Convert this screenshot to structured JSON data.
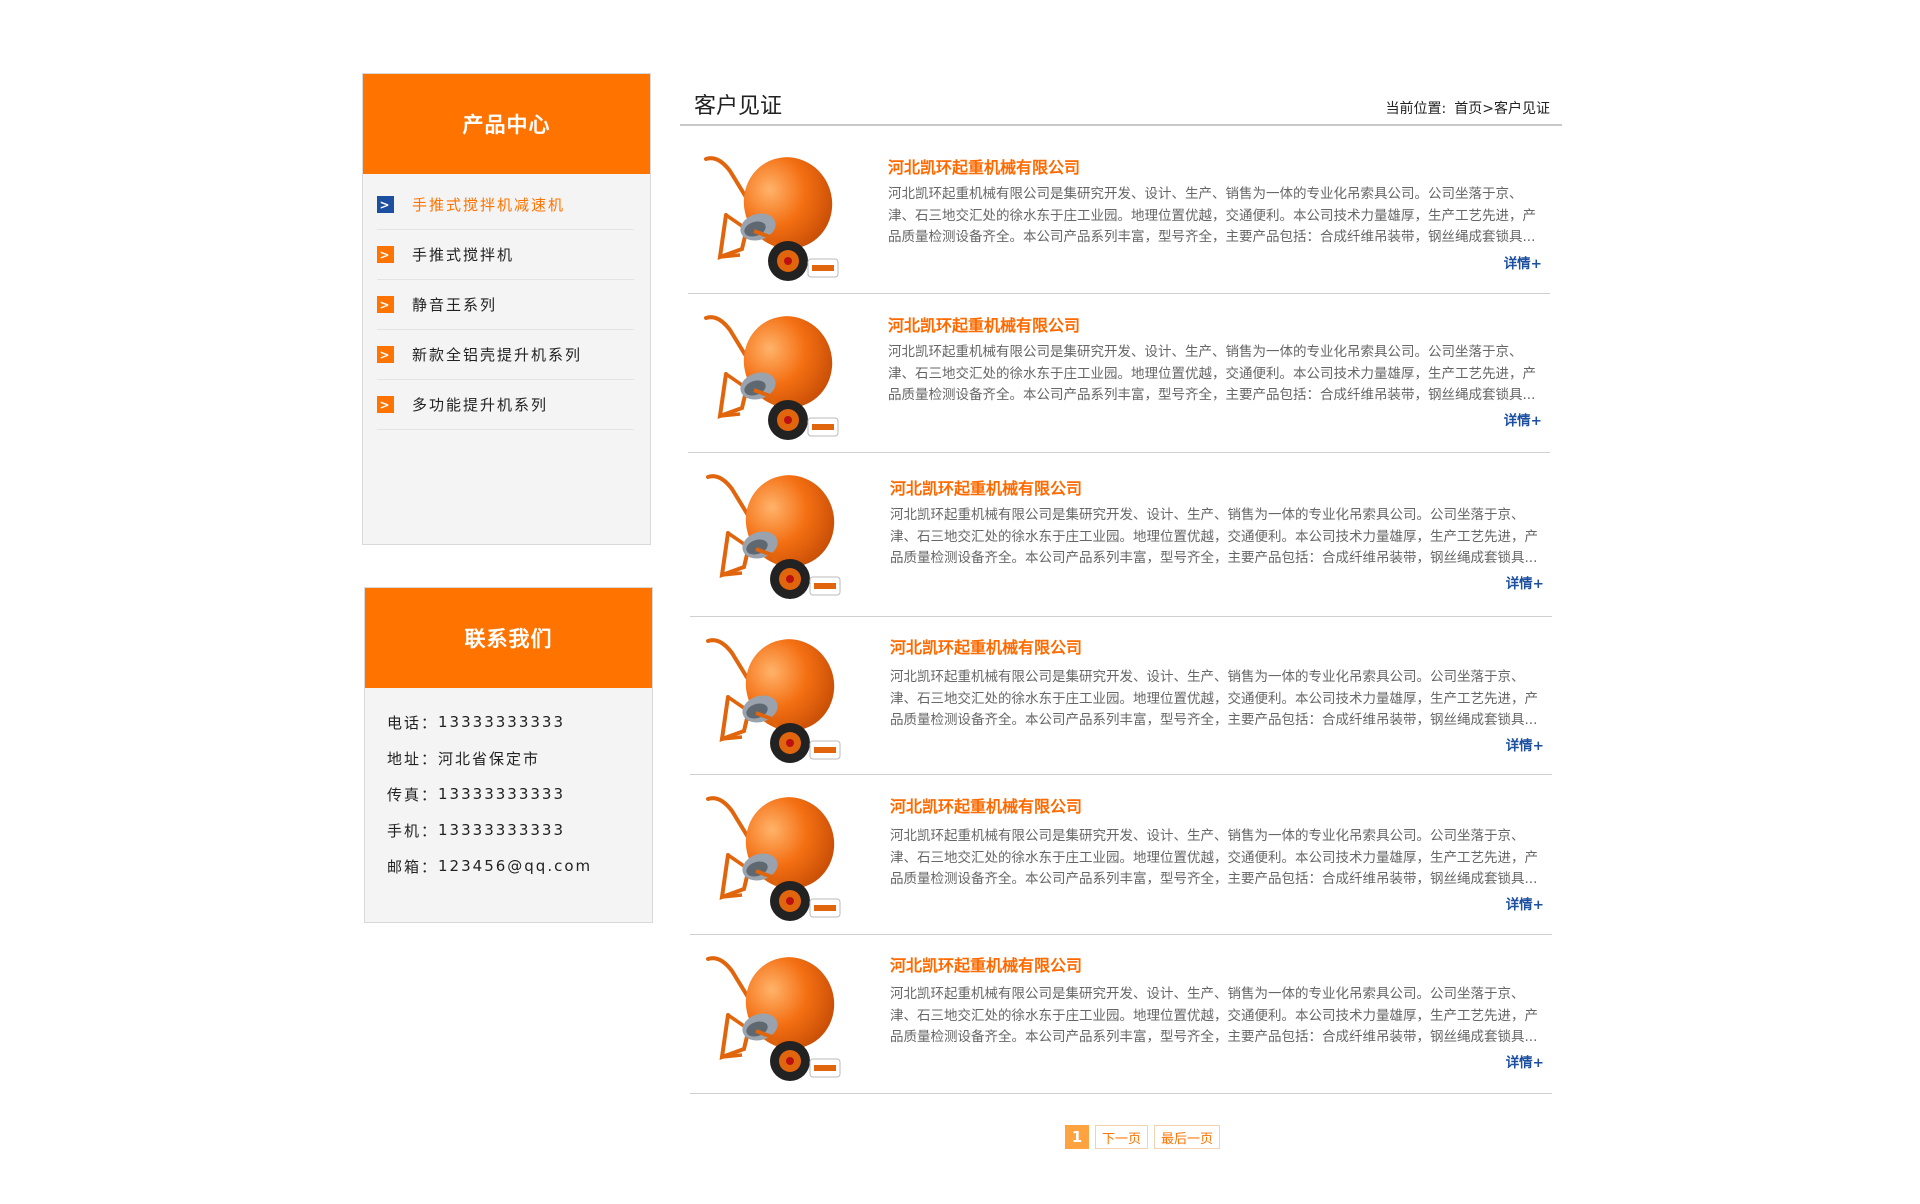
{
  "sidebar": {
    "products": {
      "title": "产品中心",
      "items": [
        {
          "label": "手推式搅拌机减速机",
          "active": true
        },
        {
          "label": "手推式搅拌机",
          "active": false
        },
        {
          "label": "静音王系列",
          "active": false
        },
        {
          "label": "新款全铝壳提升机系列",
          "active": false
        },
        {
          "label": "多功能提升机系列",
          "active": false
        }
      ]
    },
    "contact": {
      "title": "联系我们",
      "rows": [
        {
          "label": "电话：",
          "value": "13333333333"
        },
        {
          "label": "地址：",
          "value": "河北省保定市"
        },
        {
          "label": "传真：",
          "value": "13333333333"
        },
        {
          "label": "手机：",
          "value": "13333333333"
        },
        {
          "label": "邮箱：",
          "value": "123456@qq.com"
        }
      ]
    }
  },
  "main": {
    "title": "客户见证",
    "breadcrumb": {
      "label": "当前位置:",
      "home": "首页",
      "sep": ">",
      "current": "客户见证"
    },
    "entries": [
      {
        "title": "河北凯环起重机械有限公司",
        "desc": "河北凯环起重机械有限公司是集研究开发、设计、生产、销售为一体的专业化吊索具公司。公司坐落于京、津、石三地交汇处的徐水东于庄工业园。地理位置优越，交通便利。本公司技术力量雄厚，生产工艺先进，产品质量检测设备齐全。本公司产品系列丰富，型号齐全，主要产品包括：合成纤维吊装带，钢丝绳成套锁具...",
        "more": "详情+"
      },
      {
        "title": "河北凯环起重机械有限公司",
        "desc": "河北凯环起重机械有限公司是集研究开发、设计、生产、销售为一体的专业化吊索具公司。公司坐落于京、津、石三地交汇处的徐水东于庄工业园。地理位置优越，交通便利。本公司技术力量雄厚，生产工艺先进，产品质量检测设备齐全。本公司产品系列丰富，型号齐全，主要产品包括：合成纤维吊装带，钢丝绳成套锁具...",
        "more": "详情+"
      },
      {
        "title": "河北凯环起重机械有限公司",
        "desc": "河北凯环起重机械有限公司是集研究开发、设计、生产、销售为一体的专业化吊索具公司。公司坐落于京、津、石三地交汇处的徐水东于庄工业园。地理位置优越，交通便利。本公司技术力量雄厚，生产工艺先进，产品质量检测设备齐全。本公司产品系列丰富，型号齐全，主要产品包括：合成纤维吊装带，钢丝绳成套锁具...",
        "more": "详情+"
      },
      {
        "title": "河北凯环起重机械有限公司",
        "desc": "河北凯环起重机械有限公司是集研究开发、设计、生产、销售为一体的专业化吊索具公司。公司坐落于京、津、石三地交汇处的徐水东于庄工业园。地理位置优越，交通便利。本公司技术力量雄厚，生产工艺先进，产品质量检测设备齐全。本公司产品系列丰富，型号齐全，主要产品包括：合成纤维吊装带，钢丝绳成套锁具...",
        "more": "详情+"
      },
      {
        "title": "河北凯环起重机械有限公司",
        "desc": "河北凯环起重机械有限公司是集研究开发、设计、生产、销售为一体的专业化吊索具公司。公司坐落于京、津、石三地交汇处的徐水东于庄工业园。地理位置优越，交通便利。本公司技术力量雄厚，生产工艺先进，产品质量检测设备齐全。本公司产品系列丰富，型号齐全，主要产品包括：合成纤维吊装带，钢丝绳成套锁具...",
        "more": "详情+"
      },
      {
        "title": "河北凯环起重机械有限公司",
        "desc": "河北凯环起重机械有限公司是集研究开发、设计、生产、销售为一体的专业化吊索具公司。公司坐落于京、津、石三地交汇处的徐水东于庄工业园。地理位置优越，交通便利。本公司技术力量雄厚，生产工艺先进，产品质量检测设备齐全。本公司产品系列丰富，型号齐全，主要产品包括：合成纤维吊装带，钢丝绳成套锁具...",
        "more": "详情+"
      }
    ]
  },
  "pager": {
    "current": "1",
    "next": "下一页",
    "last": "最后一页"
  },
  "colors": {
    "accent": "#ff7300",
    "link_blue": "#1c4fa0",
    "panel_bg": "#f4f4f4"
  },
  "icons": {
    "list_bullet": "chevron-right-icon",
    "thumbnail": "cement-mixer-image"
  }
}
